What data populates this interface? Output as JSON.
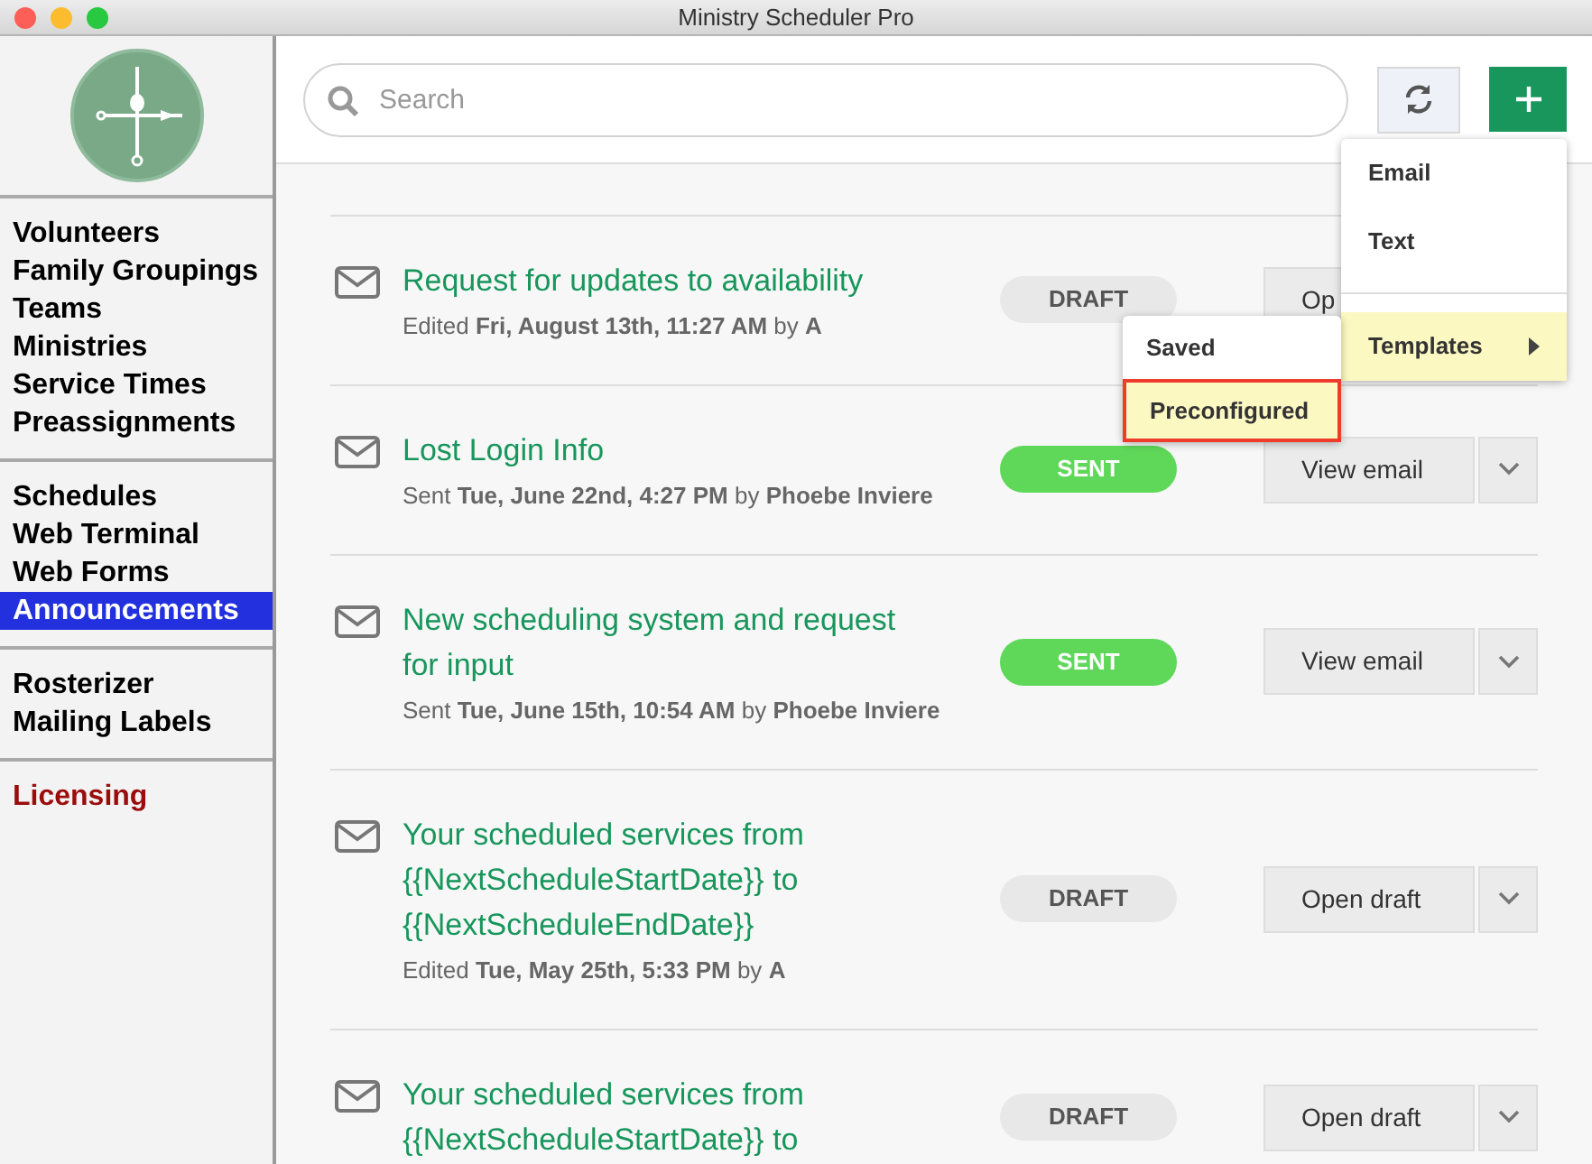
{
  "window": {
    "title": "Ministry Scheduler Pro"
  },
  "sidebar": {
    "groups": [
      {
        "items": [
          {
            "label": "Volunteers",
            "selected": false,
            "kind": "nav"
          },
          {
            "label": "Family Groupings",
            "selected": false,
            "kind": "nav"
          },
          {
            "label": "Teams",
            "selected": false,
            "kind": "nav"
          },
          {
            "label": "Ministries",
            "selected": false,
            "kind": "nav"
          },
          {
            "label": "Service Times",
            "selected": false,
            "kind": "nav"
          },
          {
            "label": "Preassignments",
            "selected": false,
            "kind": "nav"
          }
        ]
      },
      {
        "items": [
          {
            "label": "Schedules",
            "selected": false,
            "kind": "nav"
          },
          {
            "label": "Web Terminal",
            "selected": false,
            "kind": "nav"
          },
          {
            "label": "Web Forms",
            "selected": false,
            "kind": "nav"
          },
          {
            "label": "Announcements",
            "selected": true,
            "kind": "nav"
          }
        ]
      },
      {
        "items": [
          {
            "label": "Rosterizer",
            "selected": false,
            "kind": "nav"
          },
          {
            "label": "Mailing Labels",
            "selected": false,
            "kind": "nav"
          }
        ]
      },
      {
        "items": [
          {
            "label": "Licensing",
            "selected": false,
            "kind": "alert"
          }
        ]
      }
    ]
  },
  "toolbar": {
    "search": {
      "placeholder": "Search"
    }
  },
  "new_menu": {
    "items": [
      {
        "label": "Email",
        "kind": "item",
        "selected": false
      },
      {
        "label": "Text",
        "kind": "item",
        "selected": false
      },
      {
        "label": "Templates",
        "kind": "submenu",
        "selected": true
      }
    ],
    "submenu": [
      {
        "label": "Saved",
        "selected": false
      },
      {
        "label": "Preconfigured",
        "selected": true
      }
    ]
  },
  "announcements": [
    {
      "title": "Request for updates to availability",
      "meta": "Edited **Fri, August 13th, 11:27 AM** by **A**",
      "status": "DRAFT",
      "kind": "draft",
      "action": "Op"
    },
    {
      "title": "Lost Login Info",
      "meta": "Sent **Tue, June 22nd, 4:27 PM** by **Phoebe Inviere**",
      "status": "SENT",
      "kind": "sent",
      "action": "View email"
    },
    {
      "title": "New scheduling system and request for input",
      "meta": "Sent **Tue, June 15th, 10:54 AM** by **Phoebe Inviere**",
      "status": "SENT",
      "kind": "sent",
      "action": "View email"
    },
    {
      "title": "Your scheduled services from {{NextScheduleStartDate}} to {{NextScheduleEndDate}}",
      "meta": "Edited **Tue, May 25th, 5:33 PM** by **A**",
      "status": "DRAFT",
      "kind": "draft",
      "action": "Open draft"
    },
    {
      "title": "Your scheduled services from {{NextScheduleStartDate}} to",
      "status": "DRAFT",
      "kind": "draft",
      "action": "Open draft"
    }
  ]
}
